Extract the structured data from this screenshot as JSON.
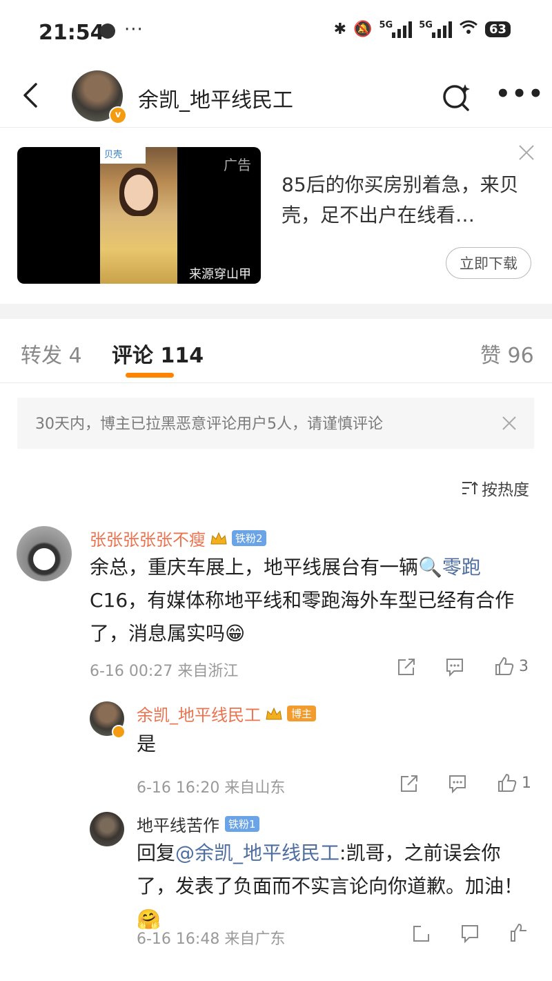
{
  "status_bar": {
    "time": "21:54",
    "dots": "···",
    "network_1": "5G",
    "network_2": "5G",
    "battery": "63"
  },
  "header": {
    "title": "余凯_地平线民工",
    "verified_badge": "v"
  },
  "ad": {
    "logo_text": "贝壳",
    "tag": "广告",
    "source": "来源穿山甲",
    "title": "85后的你买房别着急，来贝壳，足不出户在线看…",
    "button": "立即下载"
  },
  "tabs": [
    {
      "label": "转发 4"
    },
    {
      "label": "评论 114"
    },
    {
      "label": "赞 96"
    }
  ],
  "notice": {
    "text": "30天内，博主已拉黑恶意评论用户5人，请谨慎评论"
  },
  "sort": {
    "label": "按热度"
  },
  "comments": [
    {
      "user": "张张张张张不瘦",
      "badge": "铁粉2",
      "text_before": "余总，重庆车展上，地平线展台有一辆",
      "search_term": "零跑",
      "text_after": "C16，有媒体称地平线和零跑海外车型已经有合作了，消息属实吗😁",
      "time": "6-16 00:27",
      "location": "来自浙江",
      "likes": "3"
    },
    {
      "user": "余凯_地平线民工",
      "badge": "博主",
      "text": "是",
      "time": "6-16 16:20",
      "location": "来自山东",
      "likes": "1"
    },
    {
      "user": "地平线苦作",
      "badge": "铁粉1",
      "reply_prefix": "回复",
      "reply_to": "@余凯_地平线民工",
      "text": ":凯哥，之前误会你了，发表了负面而不实言论向你道歉。加油！🤗",
      "time": "6-16 16:48",
      "location": "来自广东"
    }
  ],
  "colors": {
    "accent_orange": "#ff8200",
    "username": "#eb7350",
    "fan_badge": "#6aa4e6",
    "host_badge": "#f29b2e"
  }
}
